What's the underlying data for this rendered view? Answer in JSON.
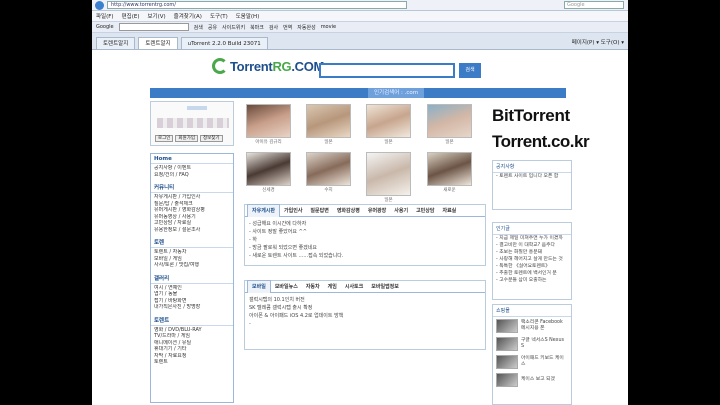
{
  "browser": {
    "url": "http://www.torrentrg.com/",
    "search_placeholder": "Google",
    "menu": [
      "파일(F)",
      "편집(E)",
      "보기(V)",
      "즐겨찾기(A)",
      "도구(T)",
      "도움말(H)"
    ],
    "toolbar": [
      "Google",
      "검색",
      "공유",
      "사이드위키",
      "북마크",
      "검사",
      "번역",
      "자동완성",
      "movie"
    ],
    "tabs": [
      "토렌트알지",
      "토렌트알지",
      "uTorrent 2.2.0 Build 23071"
    ],
    "tools": "페이지(P) ▾  도구(O) ▾"
  },
  "site": {
    "logo": {
      "main": "Torrent",
      "accent": "RG",
      "suffix": ".COM"
    },
    "search_button": "검색",
    "keyword_bar": "인기검색어 : .com",
    "login_buttons": [
      "로그인",
      "회원가입",
      "정보찾기"
    ],
    "sidebar": [
      {
        "section": "Home",
        "items": [
          "공지사항 / 이벤트",
          "요청/건의 / FAQ"
        ]
      },
      {
        "section": "커뮤니티",
        "items": [
          "자유게시판 / 가입인사",
          "질문/답 / 출석체크",
          "유머게시판 / 영화감상평",
          "유머동영상 / 사용기",
          "고민상담 / 자료실",
          "유용한정보 / 설문조사"
        ]
      },
      {
        "section": "토렌",
        "items": [
          "토렌트 / 자동차",
          "모바일 / 게임",
          "사사/토론 / 맛집/여행"
        ]
      },
      {
        "section": "갤러리",
        "items": [
          "여시 / 연예인",
          "엽기 / 동물",
          "접기 / 바탕화면",
          "내가직은사진 / 방명장"
        ]
      },
      {
        "section": "토렌트",
        "items": [
          "영화 / DVD/BLU-RAY",
          "TV/드라마 / 게임",
          "애니메이션 / 유틸",
          "휴대기기 / 기타",
          "자막 / 자료요청",
          "토렌트"
        ]
      }
    ],
    "photos": [
      {
        "label": "아이유 김규리"
      },
      {
        "label": "일본"
      },
      {
        "label": "일본"
      },
      {
        "label": "일본"
      },
      {
        "label": "신세경"
      },
      {
        "label": "수지"
      },
      {
        "label": "일본"
      },
      {
        "label": "새로운"
      }
    ],
    "box1": {
      "tabs": [
        "자유게시판",
        "가입인사",
        "질문답변",
        "영화감상평",
        "유머광장",
        "사용기",
        "고민상담",
        "자료실"
      ],
      "lines": [
        "- 성급해요 이시간에 다하자",
        "- 사이트 정말 좋았어요 ^^",
        "- 하",
        "- 방금 팔로워 되었으면 좋겠네요",
        "- 새로운 토렌트 사이트 ......접속 되었습니다."
      ]
    },
    "box2": {
      "tabs": [
        "모바일",
        "모바일뉴스",
        "자동차",
        "게임",
        "시사토크",
        "모바일앱정보"
      ],
      "lines": [
        "갤럭시탭의 10.1인치 버전",
        "SK 텔레콤 갤럭시탭 출시 확정",
        "아이폰 & 아이패드 iOS 4.2로 업데이트 방책",
        "-"
      ]
    },
    "right": {
      "bittorrent": "BitTorrent",
      "domain": "Torrent.co.kr",
      "notice_title": "공지사항",
      "notice_lines": [
        "- 토렌트 사이트 입니다 오픈 합"
      ],
      "recent_title": "인기글",
      "recent_lines": [
        "- 지금 제일 미쳐주면 누가 이겼까",
        "- 결고비만 이 대학교? 음주다",
        "- 초보는 화질만 흥분돼",
        "- 사랑해 헤어지고 살게 만드는 것",
        "- 독특한 《싫어요토렌트》",
        "- 추출한 토렌트에 백서인거 분",
        "- 고수분들 삼미 오출하는"
      ],
      "shop_title": "쇼핑몰",
      "products": [
        "팩소리콘 Facebook 메시지용 폰",
        "구글 넥서스S Nexus S",
        "아이패드 키보드 케이스",
        "케이스 보고 되겠"
      ]
    }
  }
}
